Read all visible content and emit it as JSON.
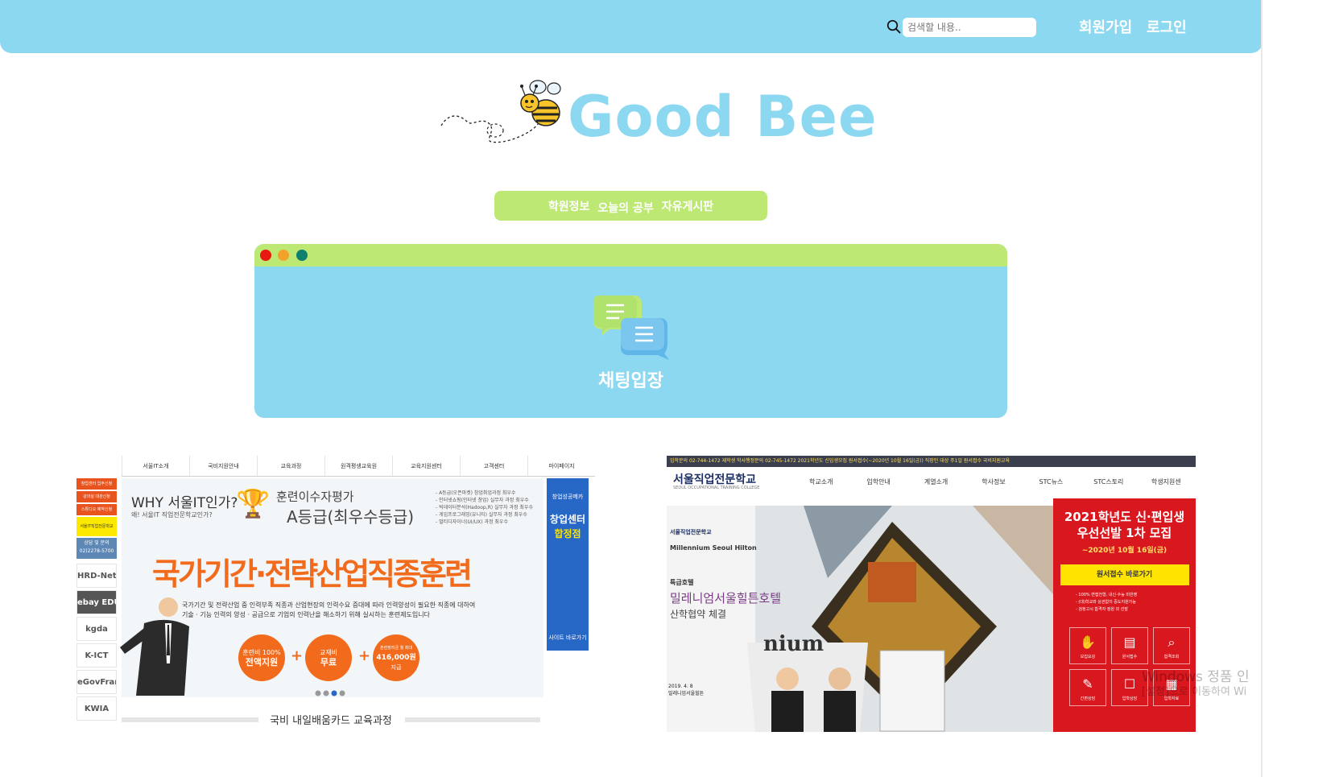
{
  "header": {
    "search_placeholder": "검색할 내용..",
    "signup_label": "회원가입",
    "login_label": "로그인",
    "bg_color": "#8cd8f1"
  },
  "logo": {
    "text": "Good Bee",
    "color": "#8cd8f1"
  },
  "menu": {
    "items": [
      "학원정보",
      "오늘의 공부",
      "자유게시판"
    ],
    "bg_color": "#bde873"
  },
  "chat_window": {
    "label": "채팅입장",
    "titlebar_dots": [
      "#e8190e",
      "#f2a12b",
      "#0f7f6e"
    ]
  },
  "banner_left": {
    "nav": [
      "서울IT소개",
      "국비지원안내",
      "교육과정",
      "원격평생교육원",
      "교육지원센터",
      "고객센터",
      "마이페이지"
    ],
    "side_buttons": [
      "창업센터 입주신청",
      "강의실 대관신청",
      "스튜디오 예약신청"
    ],
    "kakao": "서울IT직업전문학교",
    "call_title": "상담 및 문의",
    "call_number": "02)2278-5700",
    "partners": [
      "HRD-Net",
      "ebay EDU",
      "kgda",
      "K-ICT",
      "eGovFrame",
      "KWIA"
    ],
    "why_title": "WHY 서울IT인가?",
    "why_sub": "왜! 서울IT 직업전문학교인가?",
    "grade_line1": "훈련이수자평가",
    "grade_line2": "A등급(최우수등급)",
    "grade_list": [
      "- A등급(오픈마켓) 창업취업과정 최우수",
      "- 인터넷쇼핑(인터넷 창업) 실무자 과정 최우수",
      "- 빅데이터분석(Hadoop,R) 실무자 과정 최우수",
      "- 게임프로그래밍(유니티) 실무자 과정 최우수",
      "- 멀티디자이너(UI/UX) 과정 최우수"
    ],
    "headline": "국가기간·전략산업직종훈련",
    "desc_line1": "국가기간 및 전략산업 중 인력부족 직종과 산업현장의 인력수요 증대에 따라 인력양성이 필요한 직종에 대하여",
    "desc_line2": "기술 · 기능 인력의 양성 · 공급으로 기업의 인력난을 해소하기 위해 실시하는 훈련제도입니다",
    "circles": [
      {
        "line1": "훈련비 100%",
        "line2": "전액지원"
      },
      {
        "line1": "교재비",
        "line2": "무료"
      },
      {
        "line1": "훈련장려금 월 최대",
        "line2": "416,000원",
        "line3": "지급"
      }
    ],
    "right_box": {
      "title": "창업성공메카",
      "big1": "창업센터",
      "big2": "합정점",
      "link": "사이트 바로가기"
    },
    "card_title": "국비 내일배움카드 교육과정"
  },
  "banner_right": {
    "top_line": "입학문의 02-744-1472   재학생 학사행정문의 02-745-1472        2021학년도 신입생모집 원서접수(~2020년 10월 16일(금))   직장인 대상 주1일 원서접수   국비지원교육",
    "school_name": "서울직업전문학교",
    "school_sub": "SEOUL OCCUPATIONAL TRAINING COLLEGE",
    "nav": [
      "학교소개",
      "입학안내",
      "계열소개",
      "학사정보",
      "STC뉴스",
      "STC스토리",
      "학생지원센"
    ],
    "hilton_logo": "서울직업전문학교",
    "hilton_name": "Millennium Seoul Hilton",
    "hero_small": "특급호텔",
    "hero_big": "밀레니엄서울힐튼호텔",
    "hero_big2": "산학협약 체결",
    "hero_date": "2019. 4. 8",
    "hero_place": "밀레니엄서울힐튼",
    "side": {
      "title1": "2021학년도 신·편입생",
      "title2": "우선선발 1차 모집",
      "deadline": "~2020년 10월 16일(금)",
      "button": "원서접수 바로가기",
      "notes": [
        "- 100% 면접전형, 내신·수능 미반영",
        "- (대)학교와 상관없이 중도지원가능",
        "- 검정고시 합격자 정원 외 선발"
      ],
      "grid": [
        {
          "icon": "✋",
          "label": "모집요강"
        },
        {
          "icon": "▤",
          "label": "원서접수"
        },
        {
          "icon": "⌕",
          "label": "합격조회"
        },
        {
          "icon": "✎",
          "label": "간편상담"
        },
        {
          "icon": "☐",
          "label": "입학상담"
        },
        {
          "icon": "▦",
          "label": "입학자료"
        }
      ]
    }
  },
  "watermark": {
    "line1": "Windows 정품 인",
    "line2": "[설정]으로 이동하여 Wi"
  }
}
